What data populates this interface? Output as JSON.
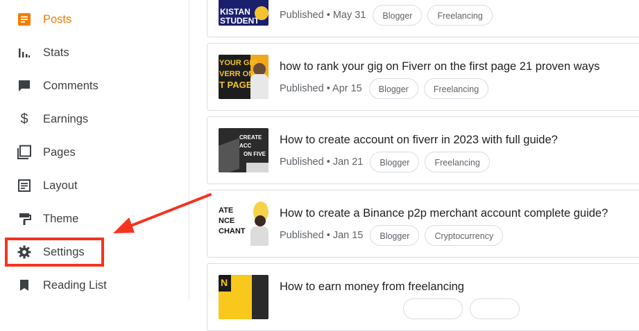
{
  "sidebar": {
    "items": [
      {
        "label": "Posts",
        "icon": "posts-icon",
        "active": true
      },
      {
        "label": "Stats",
        "icon": "stats-icon"
      },
      {
        "label": "Comments",
        "icon": "comments-icon"
      },
      {
        "label": "Earnings",
        "icon": "dollar-icon"
      },
      {
        "label": "Pages",
        "icon": "pages-icon"
      },
      {
        "label": "Layout",
        "icon": "layout-icon"
      },
      {
        "label": "Theme",
        "icon": "paint-roller-icon"
      },
      {
        "label": "Settings",
        "icon": "gear-icon"
      },
      {
        "label": "Reading List",
        "icon": "bookmark-icon"
      }
    ]
  },
  "colors": {
    "accent": "#f57c00",
    "highlight": "#f5331f"
  },
  "posts": [
    {
      "title": "",
      "status": "Published • May 31",
      "labels": [
        "Blogger",
        "Freelancing"
      ],
      "thumb_text": [
        "KISTAN",
        "STUDENT"
      ]
    },
    {
      "title": "how to rank your gig on Fiverr on the first page 21 proven ways",
      "status": "Published • Apr 15",
      "labels": [
        "Blogger",
        "Freelancing"
      ],
      "thumb_text": [
        "YOUR GIG",
        "VERR ON",
        "T PAGE"
      ]
    },
    {
      "title": "How to create account on fiverr in 2023 with full guide?",
      "status": "Published • Jan 21",
      "labels": [
        "Blogger",
        "Freelancing"
      ],
      "thumb_text": [
        "CREATE ACC",
        "ON FIVE"
      ]
    },
    {
      "title": "How to create a Binance p2p merchant account complete guide?",
      "status": "Published • Jan 15",
      "labels": [
        "Blogger",
        "Cryptocurrency"
      ],
      "thumb_text": [
        "ATE",
        "NCE",
        "CHANT"
      ]
    },
    {
      "title": "How to earn money from freelancing",
      "status": "",
      "labels": [],
      "thumb_text": [
        "N"
      ]
    }
  ]
}
